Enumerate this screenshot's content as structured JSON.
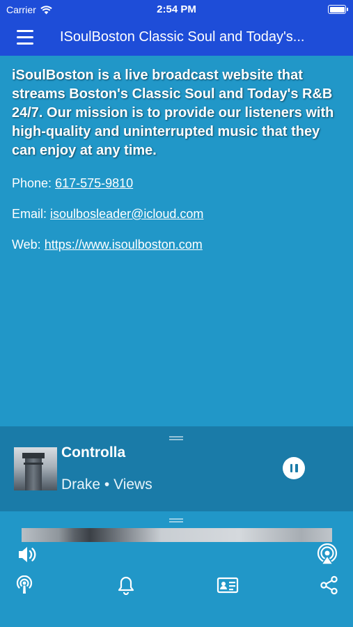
{
  "status_bar": {
    "carrier": "Carrier",
    "time": "2:54 PM"
  },
  "nav": {
    "title": "ISoulBoston Classic Soul and Today's..."
  },
  "content": {
    "mission": "iSoulBoston is a live broadcast website that streams Boston's Classic Soul and Today's R&B 24/7. Our mission is to provide our listeners with high-quality and uninterrupted music that they can enjoy at any time.",
    "phone_label": "Phone:",
    "phone": "617-575-9810",
    "email_label": "Email:",
    "email": "isoulbosleader@icloud.com",
    "web_label": "Web:",
    "web": "https://www.isoulboston.com"
  },
  "player": {
    "song_title": "Controlla",
    "artist": "Drake",
    "separator": "•",
    "album": "Views"
  },
  "colors": {
    "nav_bg": "#1e4dd8",
    "page_bg": "#2197c8",
    "player_bg": "#1a7ba8"
  },
  "icons": {
    "menu": "hamburger-icon",
    "volume": "speaker-icon",
    "airplay": "airplay-icon",
    "podcast": "broadcast-icon",
    "bell": "bell-icon",
    "contact": "contact-card-icon",
    "share": "share-icon",
    "pause": "pause-icon"
  }
}
